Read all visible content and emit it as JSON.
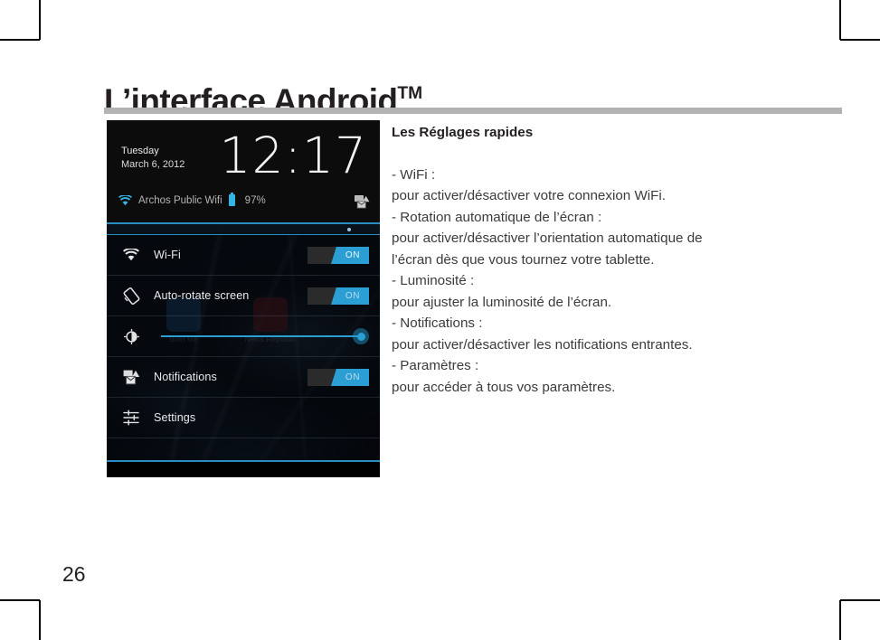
{
  "page": {
    "title_main": "L’interface Android",
    "title_tm": "TM",
    "number": "26"
  },
  "body": {
    "lead": "Les Réglages rapides",
    "lines": [
      "- WiFi :",
      "pour activer/désactiver votre connexion WiFi.",
      "- Rotation automatique de l’écran :",
      "pour activer/désactiver l’orientation automatique de",
      "l’écran dès que vous tournez votre tablette.",
      "- Luminosité :",
      "pour ajuster la luminosité de l’écran.",
      "- Notifications :",
      "pour activer/désactiver les notifications entrantes.",
      "- Paramètres :",
      "pour accéder à tous vos paramètres."
    ]
  },
  "screenshot": {
    "status": {
      "weekday": "Tuesday",
      "date": "March 6, 2012",
      "clock": "12:17",
      "ssid": "Archos Public Wifi",
      "battery": "97%",
      "wifi_icon": "wifi-icon",
      "battery_icon": "battery-icon",
      "notification_icon": "notification-alert-icon"
    },
    "ghost_apps": [
      {
        "label": "Brief Me",
        "icon": "brief-me-app-icon"
      },
      {
        "label": "News Republic",
        "icon": "news-republic-app-icon"
      }
    ],
    "rows": [
      {
        "label": "Wi-Fi",
        "icon": "wifi-icon",
        "toggle": "ON"
      },
      {
        "label": "Auto-rotate screen",
        "icon": "rotate-icon",
        "toggle": "ON"
      },
      {
        "label": "",
        "icon": "brightness-icon",
        "toggle": ""
      },
      {
        "label": "Notifications",
        "icon": "notification-icon",
        "toggle": "ON"
      },
      {
        "label": "Settings",
        "icon": "settings-icon",
        "toggle": ""
      }
    ],
    "brightness_value": 100
  },
  "colors": {
    "accent_blue": "#2b9fd4",
    "rule_gray": "#b3b3b3",
    "ink": "#231f20",
    "body_text": "#3b3b3b"
  }
}
